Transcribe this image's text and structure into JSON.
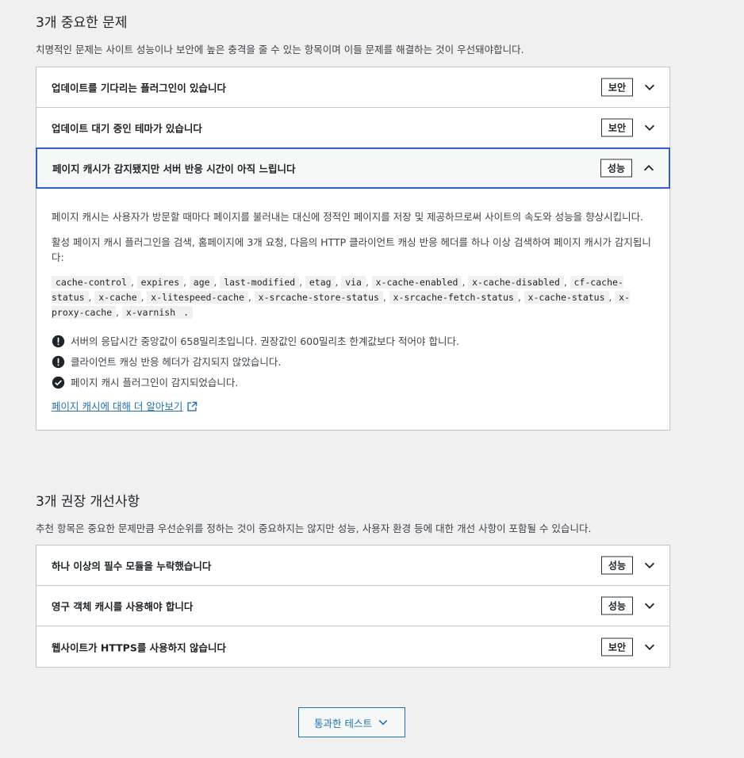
{
  "critical": {
    "title": "3개 중요한 문제",
    "description": "치명적인 문제는 사이트 성능이나 보안에 높은 충격을 줄 수 있는 항목이며 이들 문제를 해결하는 것이 우선돼야합니다.",
    "items": [
      {
        "label": "업데이트를 기다리는 플러그인이 있습니다",
        "badge": "보안"
      },
      {
        "label": "업데이트 대기 중인 테마가 있습니다",
        "badge": "보안"
      },
      {
        "label": "페이지 캐시가 감지됐지만 서버 반응 시간이 아직 느립니다",
        "badge": "성능"
      }
    ],
    "expanded": {
      "p1": "페이지 캐시는 사용자가 방문할 때마다 페이지를 불러내는 대신에 정적인 페이지를 저장 및 제공하므로써 사이트의 속도와 성능을 향상시킵니다.",
      "p2": "활성 페이지 캐시 플러그인을 검색, 홈페이지에 3개 요청, 다음의 HTTP 클라이언트 캐싱 반응 헤더를 하나 이상 검색하여 페이지 캐시가 감지됩니다:",
      "headers": [
        "cache-control",
        "expires",
        "age",
        "last-modified",
        "etag",
        "via",
        "x-cache-enabled",
        "x-cache-disabled",
        "cf-cache-status",
        "x-cache",
        "x-litespeed-cache",
        "x-srcache-store-status",
        "x-srcache-fetch-status",
        "x-cache-status",
        "x-proxy-cache",
        "x-varnish"
      ],
      "checks": [
        {
          "text": "서버의 응답시간 중앙값이 658밀리초입니다. 권장값인 600밀리초 한계값보다 적어야 합니다.",
          "status": "error"
        },
        {
          "text": "클라이언트 캐싱 반응 헤더가 감지되지 않았습니다.",
          "status": "error"
        },
        {
          "text": "페이지 캐시 플러그인이 감지되었습니다.",
          "status": "ok"
        }
      ],
      "link": "페이지 캐시에 대해 더 알아보기"
    }
  },
  "recommended": {
    "title": "3개 권장 개선사항",
    "description": "추천 항목은 중요한 문제만큼 우선순위를 정하는 것이 중요하지는 않지만 성능, 사용자 환경 등에 대한 개선 사항이 포함될 수 있습니다.",
    "items": [
      {
        "label": "하나 이상의 필수 모듈을 누락했습니다",
        "badge": "성능"
      },
      {
        "label": "영구 객체 캐시를 사용해야 합니다",
        "badge": "성능"
      },
      {
        "label": "웹사이트가 HTTPS를 사용하지 않습니다",
        "badge": "보안"
      }
    ]
  },
  "passed_button": "통과한 테스트",
  "colors": {
    "accent": "#2271b1",
    "focus": "#2f5fd0",
    "error": "#1d2327"
  }
}
